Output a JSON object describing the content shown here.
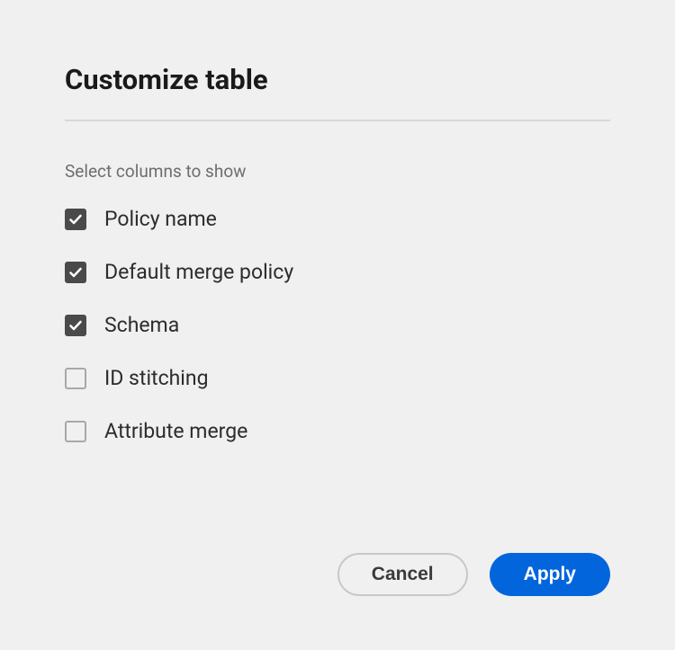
{
  "dialog": {
    "title": "Customize table",
    "subtitle": "Select columns to show",
    "options": [
      {
        "label": "Policy name",
        "checked": true
      },
      {
        "label": "Default merge policy",
        "checked": true
      },
      {
        "label": "Schema",
        "checked": true
      },
      {
        "label": "ID stitching",
        "checked": false
      },
      {
        "label": "Attribute merge",
        "checked": false
      }
    ],
    "buttons": {
      "cancel": "Cancel",
      "apply": "Apply"
    },
    "colors": {
      "accent": "#0265dc",
      "checkbox_fill": "#4a4a4a"
    }
  }
}
